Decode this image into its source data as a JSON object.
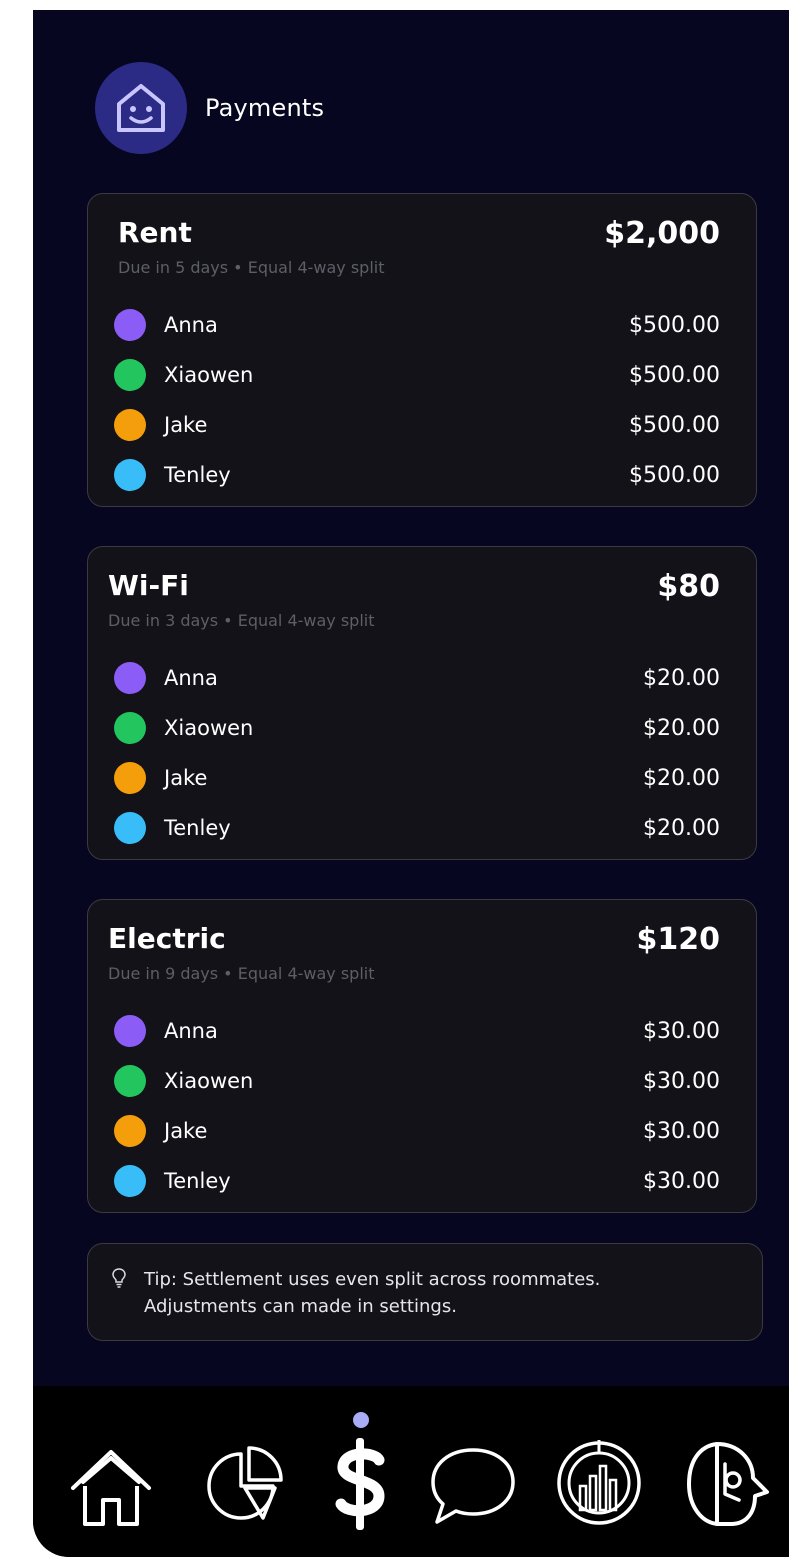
{
  "header": {
    "title": "Payments",
    "avatar_icon": "smiling-house-icon"
  },
  "colors": {
    "background": "#060620",
    "card": "#121218",
    "anna": "#8b5cf6",
    "xiaowen": "#22c55e",
    "jake": "#f59e0b",
    "tenley": "#38bdf8",
    "active_indicator": "#a8acf6"
  },
  "bills": [
    {
      "name": "Rent",
      "total": "$2,000",
      "subtitle": "Due in 5 days • Equal 4-way split",
      "splits": [
        {
          "name": "Anna",
          "amount": "$500.00"
        },
        {
          "name": "Xiaowen",
          "amount": "$500.00"
        },
        {
          "name": "Jake",
          "amount": "$500.00"
        },
        {
          "name": "Tenley",
          "amount": "$500.00"
        }
      ]
    },
    {
      "name": "Wi-Fi",
      "total": "$80",
      "subtitle": "Due in 3 days • Equal 4-way split",
      "splits": [
        {
          "name": "Anna",
          "amount": "$20.00"
        },
        {
          "name": "Xiaowen",
          "amount": "$20.00"
        },
        {
          "name": "Jake",
          "amount": "$20.00"
        },
        {
          "name": "Tenley",
          "amount": "$20.00"
        }
      ]
    },
    {
      "name": "Electric",
      "total": "$120",
      "subtitle": "Due in 9 days • Equal 4-way split",
      "splits": [
        {
          "name": "Anna",
          "amount": "$30.00"
        },
        {
          "name": "Xiaowen",
          "amount": "$30.00"
        },
        {
          "name": "Jake",
          "amount": "$30.00"
        },
        {
          "name": "Tenley",
          "amount": "$30.00"
        }
      ]
    }
  ],
  "tip": {
    "line1": "Tip: Settlement uses even split across roommates.",
    "line2": "Adjustments can made in settings.",
    "icon": "lightbulb-icon"
  },
  "nav": {
    "items": [
      "home-icon",
      "pie-chart-icon",
      "dollar-icon",
      "chat-bubble-icon",
      "stats-globe-icon",
      "profile-face-icon"
    ],
    "active": "dollar-icon"
  }
}
